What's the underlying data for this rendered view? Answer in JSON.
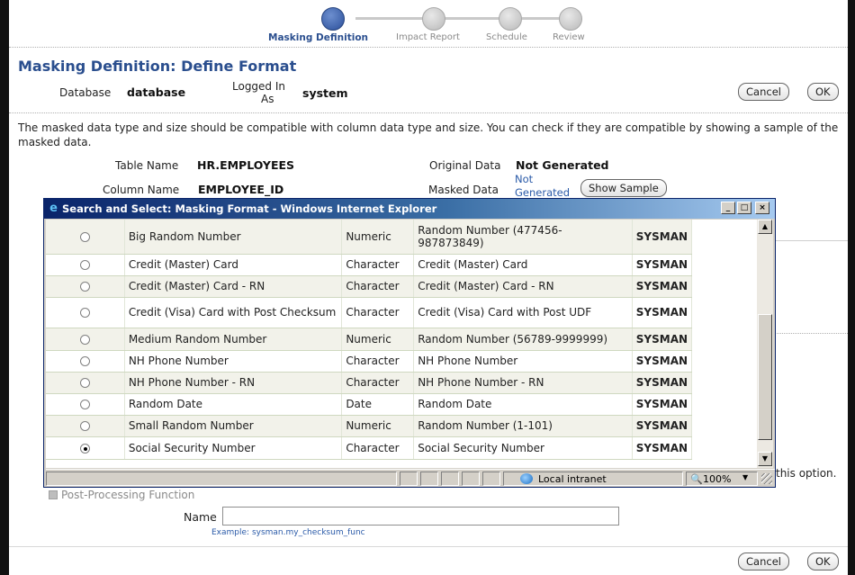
{
  "train": {
    "steps": [
      "Masking Definition",
      "Impact Report",
      "Schedule",
      "Review"
    ]
  },
  "page": {
    "title": "Masking Definition: Define Format",
    "database_label": "Database",
    "database_value": "database",
    "logged_in_label_1": "Logged In",
    "logged_in_label_2": "As",
    "logged_in_value": "system",
    "cancel_label": "Cancel",
    "ok_label": "OK",
    "instructions": "The masked data type and size should be compatible with column data type and size. You can check if they are compatible by showing a sample of the masked data.",
    "table_name_label": "Table Name",
    "table_name_value": "HR.EMPLOYEES",
    "column_name_label": "Column Name",
    "column_name_value": "EMPLOYEE_ID",
    "original_data_label": "Original Data",
    "original_data_value": "Not Generated",
    "masked_data_label": "Masked Data",
    "masked_data_value_1": "Not",
    "masked_data_value_2": "Generated",
    "show_sample_label": "Show Sample",
    "option_tail": "this option.",
    "post_processing_label": "Post-Processing Function",
    "name_label": "Name",
    "name_value": "",
    "example_text": "Example: sysman.my_checksum_func"
  },
  "popup": {
    "title": "Search and Select: Masking Format - Windows Internet Explorer",
    "rows": [
      {
        "name": "Big Random Number",
        "type": "Numeric",
        "desc": "Random Number (477456-987873849)",
        "owner": "SYSMAN",
        "selected": false
      },
      {
        "name": "Credit (Master) Card",
        "type": "Character",
        "desc": "Credit (Master) Card",
        "owner": "SYSMAN",
        "selected": false
      },
      {
        "name": "Credit (Master) Card - RN",
        "type": "Character",
        "desc": "Credit (Master) Card - RN",
        "owner": "SYSMAN",
        "selected": false
      },
      {
        "name": "Credit (Visa) Card with Post Checksum",
        "type": "Character",
        "desc": "Credit (Visa) Card with Post UDF",
        "owner": "SYSMAN",
        "selected": false
      },
      {
        "name": "Medium Random Number",
        "type": "Numeric",
        "desc": "Random Number (56789-9999999)",
        "owner": "SYSMAN",
        "selected": false
      },
      {
        "name": "NH Phone Number",
        "type": "Character",
        "desc": "NH Phone Number",
        "owner": "SYSMAN",
        "selected": false
      },
      {
        "name": "NH Phone Number - RN",
        "type": "Character",
        "desc": "NH Phone Number - RN",
        "owner": "SYSMAN",
        "selected": false
      },
      {
        "name": "Random Date",
        "type": "Date",
        "desc": "Random Date",
        "owner": "SYSMAN",
        "selected": false
      },
      {
        "name": "Small Random Number",
        "type": "Numeric",
        "desc": "Random Number (1-101)",
        "owner": "SYSMAN",
        "selected": false
      },
      {
        "name": "Social Security Number",
        "type": "Character",
        "desc": "Social Security Number",
        "owner": "SYSMAN",
        "selected": true
      }
    ],
    "status_zone": "Local intranet",
    "zoom": "100%"
  }
}
